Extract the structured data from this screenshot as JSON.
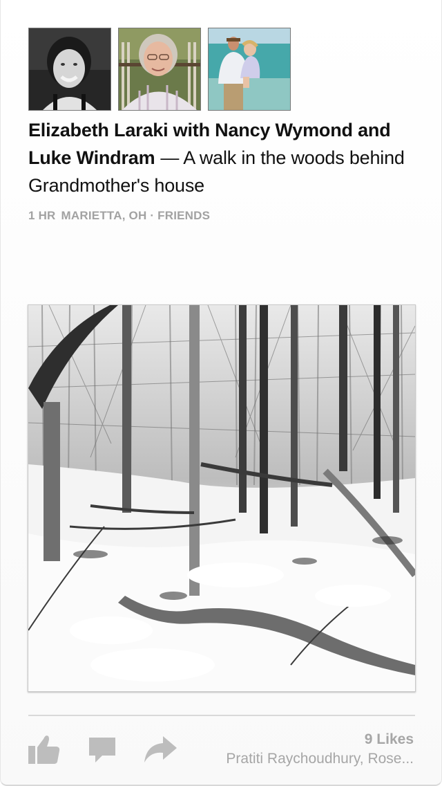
{
  "post": {
    "author_line": "Elizabeth Laraki with Nancy Wymond and Luke Windram",
    "dash": "—",
    "caption": "A walk in the woods behind Grandmother's house",
    "time": "1 HR",
    "location": "MARIETTA, OH · FRIENDS",
    "avatars": [
      {
        "name": "elizabeth-laraki-avatar"
      },
      {
        "name": "nancy-wymond-avatar"
      },
      {
        "name": "luke-windram-avatar"
      }
    ],
    "photo_name": "snowy-woods-photo"
  },
  "footer": {
    "likes": "9 Likes",
    "likers": "Pratiti Raychoudhury, Rose...",
    "icons": [
      "like-icon",
      "comment-icon",
      "share-icon"
    ]
  },
  "colors": {
    "text": "#111111",
    "meta": "#a2a2a2",
    "icon": "#bdbdbd"
  }
}
